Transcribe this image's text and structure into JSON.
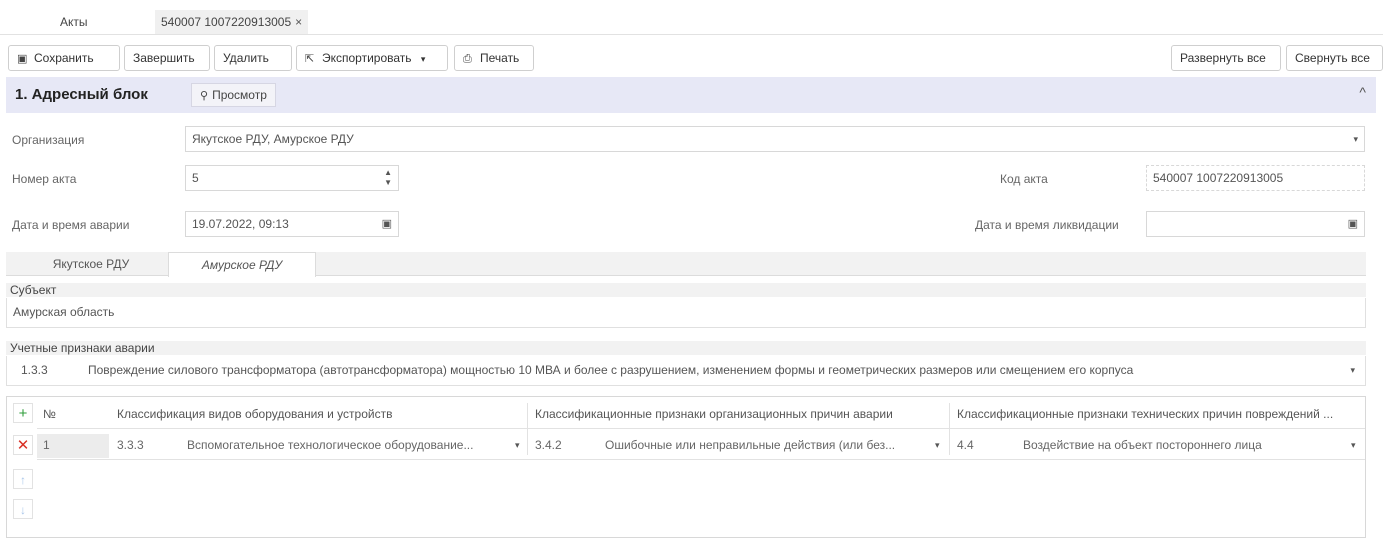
{
  "tabs": [
    {
      "label": "Акты"
    },
    {
      "label": "540007 1007220913005",
      "close": "×"
    }
  ],
  "toolbar": {
    "save": "Сохранить",
    "finish": "Завершить",
    "delete": "Удалить",
    "export": "Экспортировать",
    "export_caret": "▾",
    "print": "Печать",
    "expand_all": "Развернуть все",
    "collapse_all": "Свернуть все"
  },
  "section": {
    "title": "1. Адресный блок",
    "preview": "Просмотр",
    "collapse_glyph": "^"
  },
  "form": {
    "organization_label": "Организация",
    "organization_value": "Якутское РДУ, Амурское РДУ",
    "act_number_label": "Номер акта",
    "act_number_value": "5",
    "act_code_label": "Код акта",
    "act_code_value": "540007 1007220913005",
    "accident_datetime_label": "Дата и время аварии",
    "accident_datetime_value": "19.07.2022, 09:13",
    "liquidation_datetime_label": "Дата и время ликвидации",
    "liquidation_datetime_value": ""
  },
  "subtabs": [
    {
      "label": "Якутское РДУ",
      "active": false
    },
    {
      "label": "Амурское РДУ",
      "active": true
    }
  ],
  "subject": {
    "label": "Субъект",
    "value": "Амурская область"
  },
  "signs": {
    "label": "Учетные признаки аварии",
    "code": "1.3.3",
    "text": "Повреждение силового трансформатора (автотрансформатора) мощностью 10 МВА и более с разрушением, изменением формы и геометрических размеров или смещением его корпуса"
  },
  "grid": {
    "headers": {
      "num": "№",
      "col1": "Классификация видов оборудования и устройств",
      "col2": "Классификационные признаки организационных причин аварии",
      "col3": "Классификационные признаки технических причин повреждений ..."
    },
    "rows": [
      {
        "num": "1",
        "c1_code": "3.3.3",
        "c1_text": "Вспомогательное технологическое оборудование...",
        "c2_code": "3.4.2",
        "c2_text": "Ошибочные или неправильные действия (или без...",
        "c3_code": "4.4",
        "c3_text": "Воздействие на объект постороннего лица"
      }
    ]
  },
  "colors": {
    "section_bg": "#e7e8f6",
    "add_green": "#2e9c3a",
    "delete_red": "#d93025",
    "arrow_blue": "#a9c6ea"
  }
}
